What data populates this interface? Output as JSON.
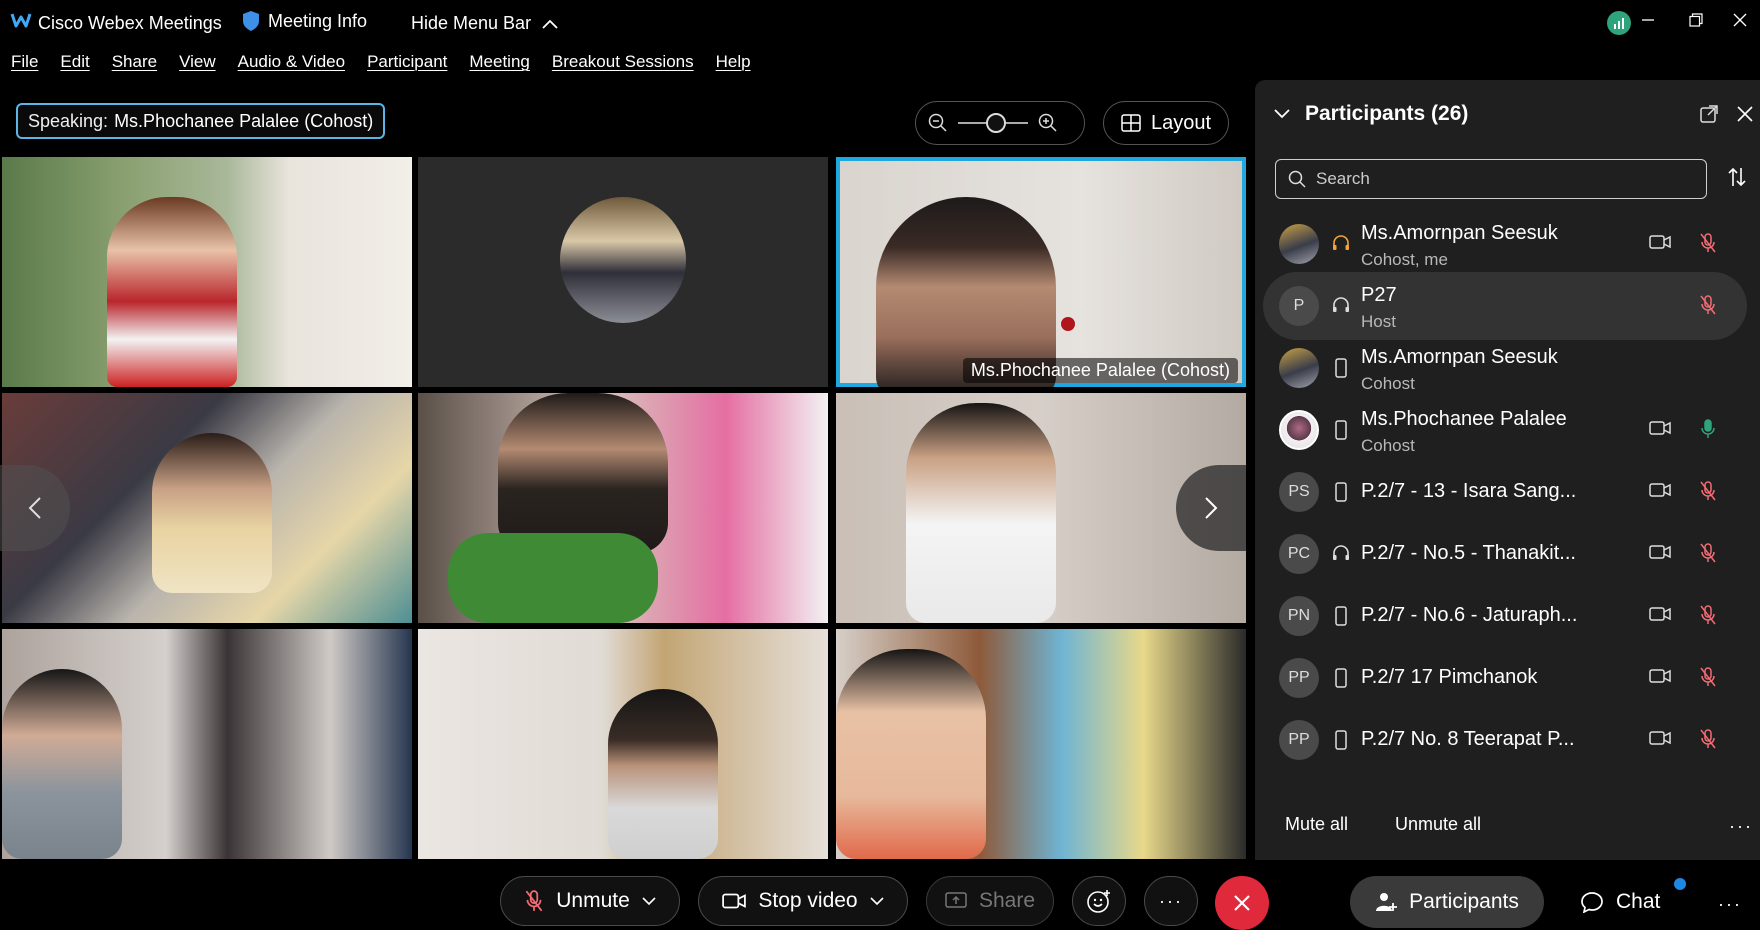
{
  "app": {
    "title": "Cisco Webex Meetings",
    "meeting_info": "Meeting Info",
    "hide_menu": "Hide Menu Bar"
  },
  "menu": [
    "File",
    "Edit",
    "Share",
    "View",
    "Audio & Video",
    "Participant",
    "Meeting",
    "Breakout Sessions",
    "Help"
  ],
  "speaking": {
    "label": "Speaking:",
    "name": "Ms.Phochanee Palalee (Cohost)"
  },
  "layout_label": "Layout",
  "active_tile_label": "Ms.Phochanee Palalee (Cohost)",
  "panel": {
    "title": "Participants (26)",
    "search_placeholder": "Search",
    "mute_all": "Mute all",
    "unmute_all": "Unmute all"
  },
  "participants": [
    {
      "name": "Ms.Amornpan Seesuk",
      "role": "Cohost, me",
      "initials": "",
      "device": "headset-icon",
      "cam": true,
      "mic": "muted"
    },
    {
      "name": "P27",
      "role": "Host",
      "initials": "P",
      "device": "headset-icon",
      "cam": false,
      "mic": "muted"
    },
    {
      "name": "Ms.Amornpan Seesuk",
      "role": "Cohost",
      "initials": "",
      "device": "phone-icon",
      "cam": false,
      "mic": "none"
    },
    {
      "name": "Ms.Phochanee Palalee",
      "role": "Cohost",
      "initials": "",
      "device": "phone-icon",
      "cam": true,
      "mic": "active"
    },
    {
      "name": "P.2/7 - 13 - Isara Sang...",
      "role": "",
      "initials": "PS",
      "device": "phone-icon",
      "cam": true,
      "mic": "muted"
    },
    {
      "name": "P.2/7 - No.5 - Thanakit...",
      "role": "",
      "initials": "PC",
      "device": "headset-icon",
      "cam": true,
      "mic": "muted"
    },
    {
      "name": "P.2/7 - No.6 - Jaturaph...",
      "role": "",
      "initials": "PN",
      "device": "phone-icon",
      "cam": true,
      "mic": "muted"
    },
    {
      "name": "P.2/7 17 Pimchanok",
      "role": "",
      "initials": "PP",
      "device": "phone-icon",
      "cam": true,
      "mic": "muted"
    },
    {
      "name": "P.2/7 No. 8 Teerapat P...",
      "role": "",
      "initials": "PP",
      "device": "phone-icon",
      "cam": true,
      "mic": "muted"
    }
  ],
  "toolbar": {
    "unmute": "Unmute",
    "stop_video": "Stop video",
    "share": "Share",
    "participants": "Participants",
    "chat": "Chat"
  }
}
